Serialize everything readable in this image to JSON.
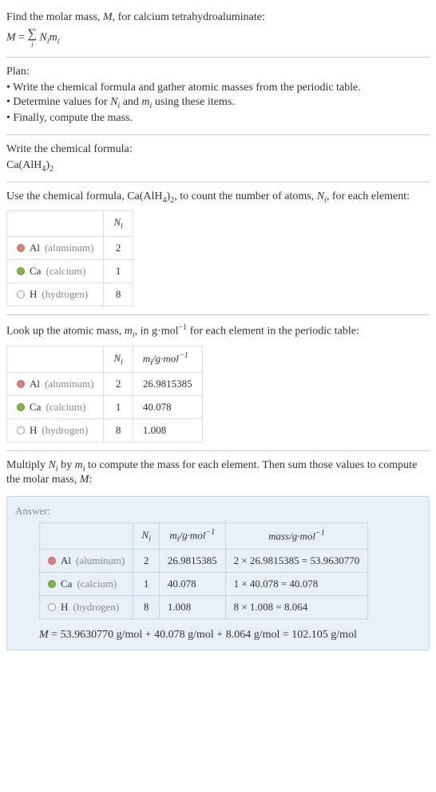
{
  "intro": {
    "line1": "Find the molar mass, ",
    "var_m": "M",
    "line1_end": ", for calcium tetrahydroaluminate:",
    "formula_left": "M",
    "formula_eq": " = ",
    "sigma": "∑",
    "sigma_sub": "i",
    "formula_right_n": "N",
    "formula_right_n_sub": "i",
    "formula_right_m": "m",
    "formula_right_m_sub": "i"
  },
  "plan": {
    "title": "Plan:",
    "items": [
      "• Write the chemical formula and gather atomic masses from the periodic table.",
      "• Determine values for ",
      "• Finally, compute the mass."
    ],
    "item2_n": "N",
    "item2_n_sub": "i",
    "item2_and": " and ",
    "item2_m": "m",
    "item2_m_sub": "i",
    "item2_end": " using these items."
  },
  "write_formula": {
    "title": "Write the chemical formula:",
    "formula_ca": "Ca(AlH",
    "formula_4": "4",
    "formula_paren": ")",
    "formula_2": "2"
  },
  "count_atoms": {
    "text1": "Use the chemical formula, Ca(AlH",
    "sub4": "4",
    "paren": ")",
    "sub2": "2",
    "text2": ", to count the number of atoms, ",
    "var_n": "N",
    "var_n_sub": "i",
    "text3": ", for each element:",
    "header_n": "N",
    "header_n_sub": "i",
    "rows": [
      {
        "symbol": "Al",
        "name": "(aluminum)",
        "dot": "dot-al",
        "n": "2"
      },
      {
        "symbol": "Ca",
        "name": "(calcium)",
        "dot": "dot-ca",
        "n": "1"
      },
      {
        "symbol": "H",
        "name": "(hydrogen)",
        "dot": "dot-h",
        "n": "8"
      }
    ]
  },
  "atomic_mass": {
    "text1": "Look up the atomic mass, ",
    "var_m": "m",
    "var_m_sub": "i",
    "text2": ", in g·mol",
    "sup_neg1": "−1",
    "text3": " for each element in the periodic table:",
    "header_n": "N",
    "header_n_sub": "i",
    "header_m": "m",
    "header_m_sub": "i",
    "header_m_unit": "/g·mol",
    "rows": [
      {
        "symbol": "Al",
        "name": "(aluminum)",
        "dot": "dot-al",
        "n": "2",
        "m": "26.9815385"
      },
      {
        "symbol": "Ca",
        "name": "(calcium)",
        "dot": "dot-ca",
        "n": "1",
        "m": "40.078"
      },
      {
        "symbol": "H",
        "name": "(hydrogen)",
        "dot": "dot-h",
        "n": "8",
        "m": "1.008"
      }
    ]
  },
  "multiply": {
    "text1": "Multiply ",
    "var_n": "N",
    "var_n_sub": "i",
    "text2": " by ",
    "var_m": "m",
    "var_m_sub": "i",
    "text3": " to compute the mass for each element. Then sum those values to compute the molar mass, ",
    "var_mm": "M",
    "text4": ":"
  },
  "answer": {
    "label": "Answer:",
    "header_n": "N",
    "header_n_sub": "i",
    "header_m": "m",
    "header_m_sub": "i",
    "header_m_unit": "/g·mol",
    "header_mass": "mass/g·mol",
    "sup_neg1": "−1",
    "rows": [
      {
        "symbol": "Al",
        "name": "(aluminum)",
        "dot": "dot-al",
        "n": "2",
        "m": "26.9815385",
        "mass": "2 × 26.9815385 = 53.9630770"
      },
      {
        "symbol": "Ca",
        "name": "(calcium)",
        "dot": "dot-ca",
        "n": "1",
        "m": "40.078",
        "mass": "1 × 40.078 = 40.078"
      },
      {
        "symbol": "H",
        "name": "(hydrogen)",
        "dot": "dot-h",
        "n": "8",
        "m": "1.008",
        "mass": "8 × 1.008 = 8.064"
      }
    ],
    "final_m": "M",
    "final_eq": " = 53.9630770 g/mol + 40.078 g/mol + 8.064 g/mol = 102.105 g/mol"
  }
}
